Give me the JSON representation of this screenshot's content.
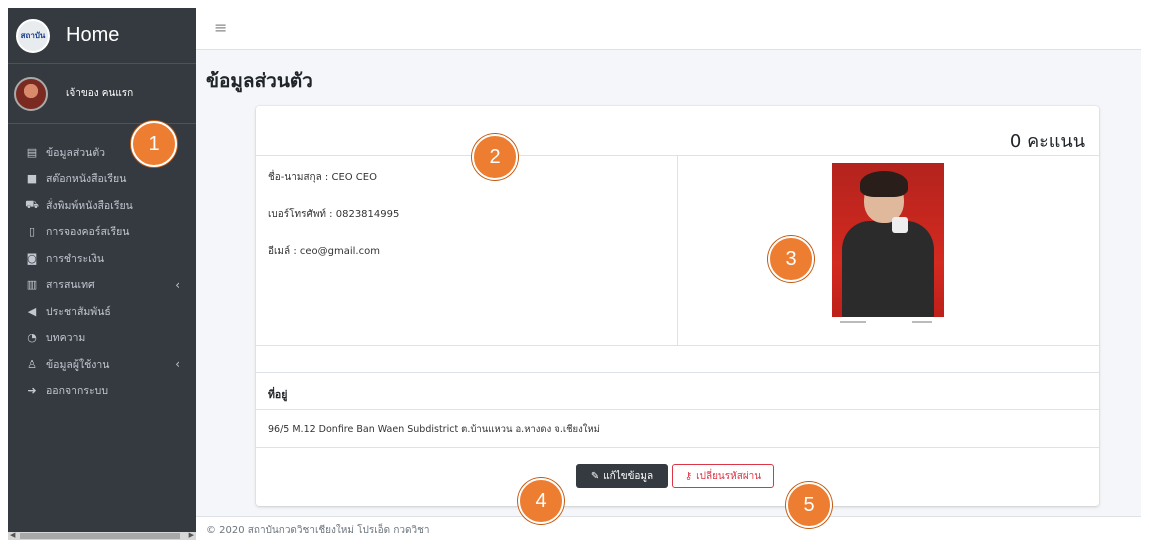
{
  "sidebar": {
    "brand_logo_text": "สถาบัน",
    "brand_title": "Home",
    "user_name": "เจ้าของ คนแรก",
    "items": [
      {
        "label": "ข้อมูลส่วนตัว",
        "icon": "id-card-icon"
      },
      {
        "label": "สต๊อกหนังสือเรียน",
        "icon": "box-icon"
      },
      {
        "label": "สั่งพิมพ์หนังสือเรียน",
        "icon": "cart-icon"
      },
      {
        "label": "การจองคอร์สเรียน",
        "icon": "document-icon"
      },
      {
        "label": "การชำระเงิน",
        "icon": "money-icon"
      },
      {
        "label": "สารสนเทศ",
        "icon": "chart-icon",
        "has_submenu": true
      },
      {
        "label": "ประชาสัมพันธ์",
        "icon": "megaphone-icon"
      },
      {
        "label": "บทความ",
        "icon": "rss-icon"
      },
      {
        "label": "ข้อมูลผู้ใช้งาน",
        "icon": "user-icon",
        "has_submenu": true
      },
      {
        "label": "ออกจากระบบ",
        "icon": "logout-icon"
      }
    ]
  },
  "topbar": {
    "menu_icon": "hamburger-icon"
  },
  "page": {
    "title": "ข้อมูลส่วนตัว"
  },
  "profile": {
    "score": "0 คะแนน",
    "name_line": "ชื่อ-นามสกุล : CEO CEO",
    "phone_line": "เบอร์โทรศัพท์ : 0823814995",
    "email_line": "อีเมล์ : ceo@gmail.com",
    "address_heading": "ที่อยู่",
    "address": "96/5 M.12 Donfire Ban Waen Subdistrict ต.บ้านแหวน อ.หางดง จ.เชียงใหม่"
  },
  "actions": {
    "edit_label": "แก้ไขข้อมูล",
    "change_password_label": "เปลี่ยนรหัสผ่าน"
  },
  "footer": {
    "text": "© 2020 สถาบันกวดวิชาเชียงใหม่ โปรเอ็ด กวดวิชา"
  },
  "markers": [
    "1",
    "2",
    "3",
    "4",
    "5"
  ],
  "colors": {
    "sidebar_bg": "#343a40",
    "marker": "#ed7d31",
    "danger": "#dc3545",
    "content_bg": "#f4f6f9"
  }
}
